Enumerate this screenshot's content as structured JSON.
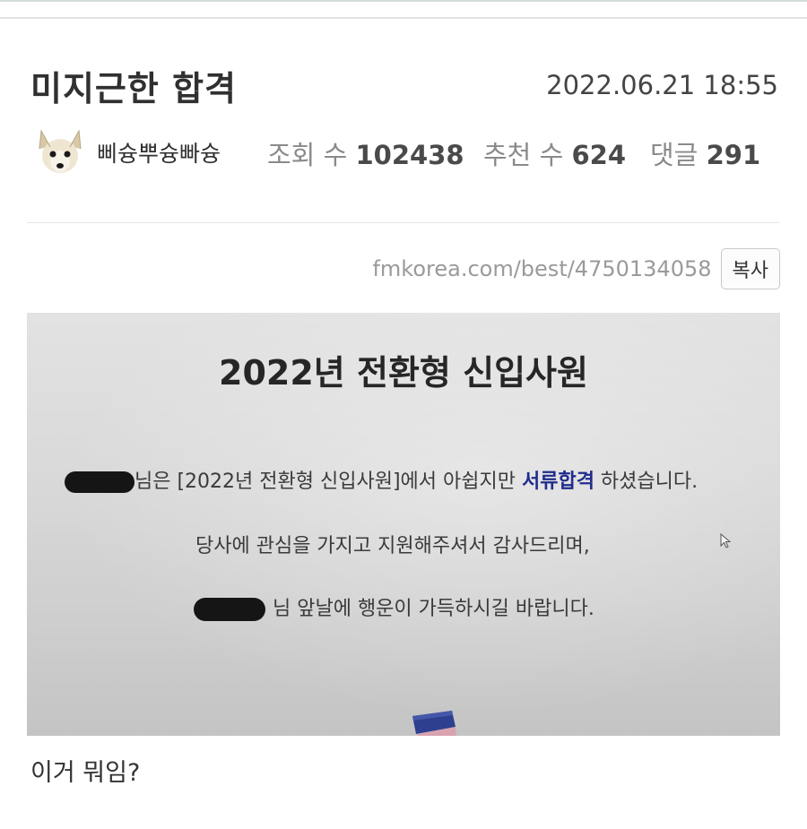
{
  "post": {
    "title": "미지근한 합격",
    "date": "2022.06.21 18:55",
    "author": "삐슝뿌슝빠슝",
    "views_label": "조회 수",
    "views": "102438",
    "recs_label": "추천 수",
    "recs": "624",
    "comments_label": "댓글",
    "comments": "291",
    "url": "fmkorea.com/best/4750134058",
    "copy_label": "복사",
    "body": "이거 뭐임?"
  },
  "photo": {
    "heading": "2022년 전환형 신입사원",
    "line1_a": "님은 [2022년 전환형 신입사원]에서 아쉽지만 ",
    "line1_highlight": "서류합격",
    "line1_b": " 하셨습니다.",
    "line2": "당사에 관심을 가지고 지원해주셔서 감사드리며,",
    "line3": "님 앞날에 행운이 가득하시길 바랍니다."
  },
  "icons": {
    "avatar": "dog-avatar-icon",
    "cursor": "mouse-cursor-icon"
  },
  "colors": {
    "highlight": "#1f2c8c"
  }
}
